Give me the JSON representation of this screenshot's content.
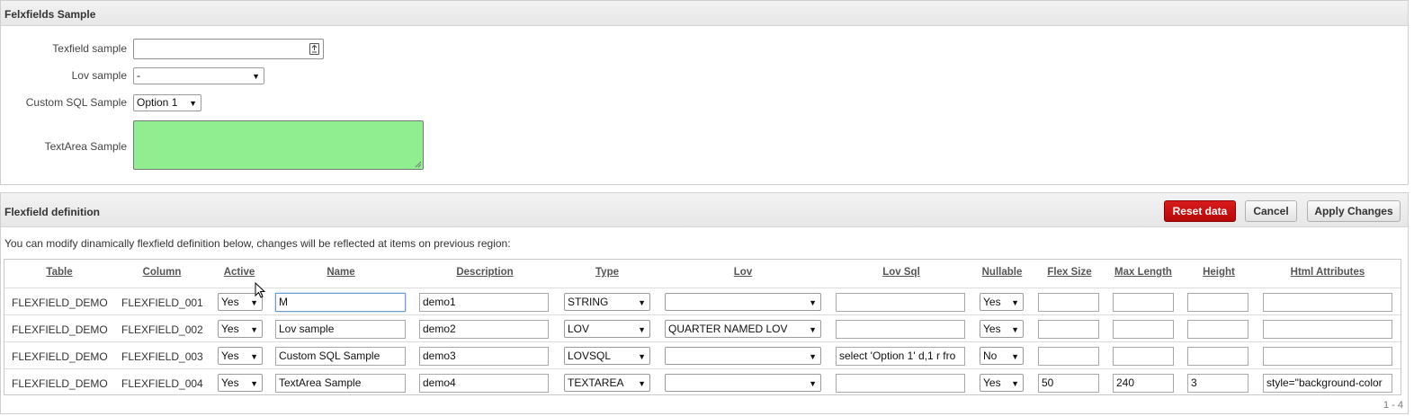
{
  "region_samples": {
    "title": "Felxfields Sample",
    "fields": [
      {
        "label": "Texfield sample",
        "value": ""
      },
      {
        "label": "Lov sample",
        "value": "-"
      },
      {
        "label": "Custom SQL Sample",
        "value": "Option 1"
      },
      {
        "label": "TextArea Sample",
        "value": ""
      }
    ],
    "textarea_color": "#90ee90"
  },
  "region_definition": {
    "title": "Flexfield definition",
    "buttons": {
      "reset": "Reset data",
      "cancel": "Cancel",
      "apply": "Apply Changes"
    },
    "hint": "You can modify dinamically flexfield definition below, changes will be reflected at items on previous region:",
    "columns": [
      "Table",
      "Column",
      "Active",
      "Name",
      "Description",
      "Type",
      "Lov",
      "Lov Sql",
      "Nullable",
      "Flex Size",
      "Max Length",
      "Height",
      "Html Attributes"
    ],
    "rows": [
      {
        "table": "FLEXFIELD_DEMO",
        "column": "FLEXFIELD_001",
        "active": "Yes",
        "name": "M",
        "description": "demo1",
        "type": "STRING",
        "lov": "",
        "lov_sql": "",
        "nullable": "Yes",
        "flex_size": "",
        "max_length": "",
        "height": "",
        "html_attributes": ""
      },
      {
        "table": "FLEXFIELD_DEMO",
        "column": "FLEXFIELD_002",
        "active": "Yes",
        "name": "Lov sample",
        "description": "demo2",
        "type": "LOV",
        "lov": "QUARTER NAMED LOV",
        "lov_sql": "",
        "nullable": "Yes",
        "flex_size": "",
        "max_length": "",
        "height": "",
        "html_attributes": ""
      },
      {
        "table": "FLEXFIELD_DEMO",
        "column": "FLEXFIELD_003",
        "active": "Yes",
        "name": "Custom SQL Sample",
        "description": "demo3",
        "type": "LOVSQL",
        "lov": "",
        "lov_sql": "select 'Option 1' d,1 r fro",
        "nullable": "No",
        "flex_size": "",
        "max_length": "",
        "height": "",
        "html_attributes": ""
      },
      {
        "table": "FLEXFIELD_DEMO",
        "column": "FLEXFIELD_004",
        "active": "Yes",
        "name": "TextArea Sample",
        "description": "demo4",
        "type": "TEXTAREA",
        "lov": "",
        "lov_sql": "",
        "nullable": "Yes",
        "flex_size": "50",
        "max_length": "240",
        "height": "3",
        "html_attributes": "style=\"background-color"
      }
    ],
    "pagination": "1 - 4"
  },
  "colors": {
    "accent_red": "#c80f0f",
    "header_bg": "#ececec"
  },
  "icons": {
    "text_field_icon": "text-field-icon",
    "dropdown_arrow": "chevron-down-icon",
    "mouse_cursor": "mouse-pointer-icon"
  }
}
